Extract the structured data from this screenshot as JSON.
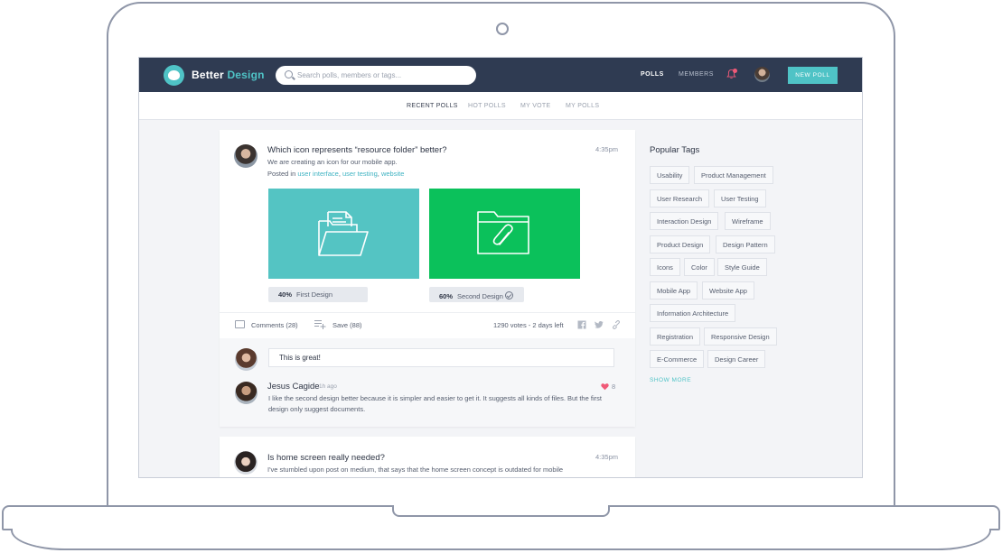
{
  "app": {
    "name_part1": "Better",
    "name_part2": "Design",
    "brand_color": "#4fc3c6",
    "nav_bg": "#2f3b52"
  },
  "header": {
    "search_placeholder": "Search polls, members or tags...",
    "nav": [
      {
        "label": "POLLS",
        "active": true
      },
      {
        "label": "MEMBERS",
        "active": false
      }
    ],
    "new_poll_label": "NEW POLL",
    "icons": [
      "bell-icon",
      "user-avatar",
      "search-icon"
    ]
  },
  "tabs": [
    {
      "label": "RECENT POLLS",
      "active": true
    },
    {
      "label": "HOT POLLS",
      "active": false
    },
    {
      "label": "MY VOTE",
      "active": false
    },
    {
      "label": "MY POLLS",
      "active": false
    }
  ],
  "poll1": {
    "title": "Which icon represents “resource folder” better?",
    "description": "We are creating an icon for our mobile app.",
    "posted_prefix": "Posted in",
    "tags": [
      "user interface",
      "user testing",
      "website"
    ],
    "time": "4:35pm",
    "options": [
      {
        "percent": "40%",
        "label": "First Design",
        "color": "#54c4c3",
        "icon": "open-folder-icon"
      },
      {
        "percent": "60%",
        "label": "Second Design",
        "color": "#0bc15b",
        "icon": "folder-attachment-icon"
      }
    ],
    "comments_label": "Comments (28)",
    "save_label": "Save (88)",
    "votes_text": "1290 votes - 2 days left",
    "comment_input_value": "This is great!",
    "comment": {
      "author": "Jesus Cagide",
      "time": "1h ago",
      "text": "I like the second design better because it is simpler and easier to get it. It suggests all kinds of files. But the first design only suggest documents.",
      "likes": "8"
    }
  },
  "poll2": {
    "title": "Is home screen really needed?",
    "description": "I've stumbled upon post on medium, that says that the home screen concept is outdated for mobile",
    "time": "4:35pm"
  },
  "sidebar": {
    "title": "Popular Tags",
    "tags": [
      "Usability",
      "Product Management",
      "User Research",
      "User Testing",
      "Interaction Design",
      "Wireframe",
      "Product Design",
      "Design Pattern",
      "Icons",
      "Color",
      "Style Guide",
      "Mobile App",
      "Website App",
      "Information Architecture",
      "Registration",
      "Responsive Design",
      "E-Commerce",
      "Design Career"
    ],
    "show_more_label": "SHOW MORE"
  }
}
